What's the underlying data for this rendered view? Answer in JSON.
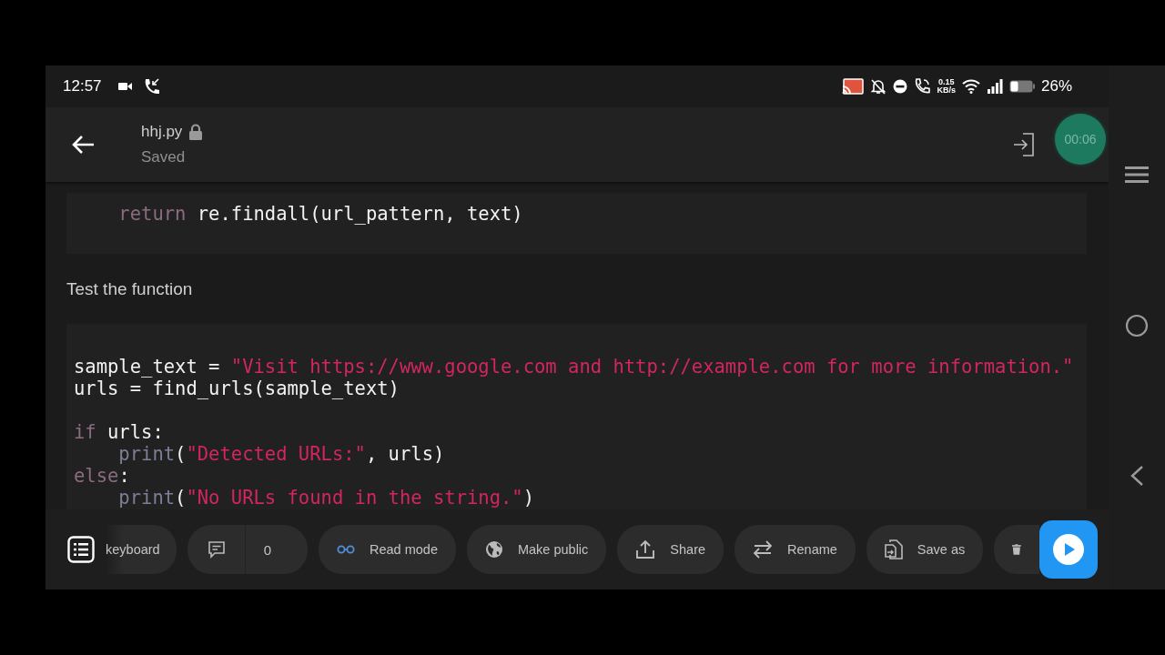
{
  "status_bar": {
    "time": "12:57",
    "speed_value": "0.15",
    "speed_unit": "KB/s",
    "battery": "26%"
  },
  "header": {
    "title": "hhj.py",
    "subtitle": "Saved"
  },
  "recording_timer": "00:06",
  "content": [
    {
      "kind": "code",
      "lines": [
        {
          "tokens": [
            {
              "kind": "keyword",
              "text": "    return"
            },
            {
              "kind": "plain",
              "text": " re.findall(url_pattern, text)"
            }
          ]
        }
      ]
    },
    {
      "kind": "text",
      "text": "Test the function"
    },
    {
      "kind": "code",
      "lines": [
        {
          "kind": "blank"
        },
        {
          "tokens": [
            {
              "kind": "plain",
              "text": "sample_text = "
            },
            {
              "kind": "string",
              "text": "\"Visit https://www.google.com and http://example.com for more information.\""
            }
          ]
        },
        {
          "tokens": [
            {
              "kind": "plain",
              "text": "urls = find_urls(sample_text)"
            }
          ]
        },
        {
          "kind": "blank"
        },
        {
          "tokens": [
            {
              "kind": "keyword",
              "text": "if"
            },
            {
              "kind": "plain",
              "text": " urls:"
            }
          ]
        },
        {
          "tokens": [
            {
              "kind": "builtin",
              "text": "    print"
            },
            {
              "kind": "plain",
              "text": "("
            },
            {
              "kind": "string",
              "text": "\"Detected URLs:\""
            },
            {
              "kind": "plain",
              "text": ", urls)"
            }
          ]
        },
        {
          "tokens": [
            {
              "kind": "keyword",
              "text": "else"
            },
            {
              "kind": "plain",
              "text": ":"
            }
          ]
        },
        {
          "tokens": [
            {
              "kind": "builtin",
              "text": "    print"
            },
            {
              "kind": "plain",
              "text": "("
            },
            {
              "kind": "string",
              "text": "\"No URLs found in the string.\""
            },
            {
              "kind": "plain",
              "text": ")"
            }
          ]
        }
      ]
    }
  ],
  "toolbar": [
    {
      "kind": "keyboard",
      "label": "keyboard"
    },
    {
      "kind": "comments",
      "count": "0"
    },
    {
      "kind": "read",
      "label": "Read mode"
    },
    {
      "kind": "public",
      "label": "Make public"
    },
    {
      "kind": "share",
      "label": "Share"
    },
    {
      "kind": "rename",
      "label": "Rename"
    },
    {
      "kind": "saveas",
      "label": "Save as"
    },
    {
      "kind": "delete"
    }
  ]
}
